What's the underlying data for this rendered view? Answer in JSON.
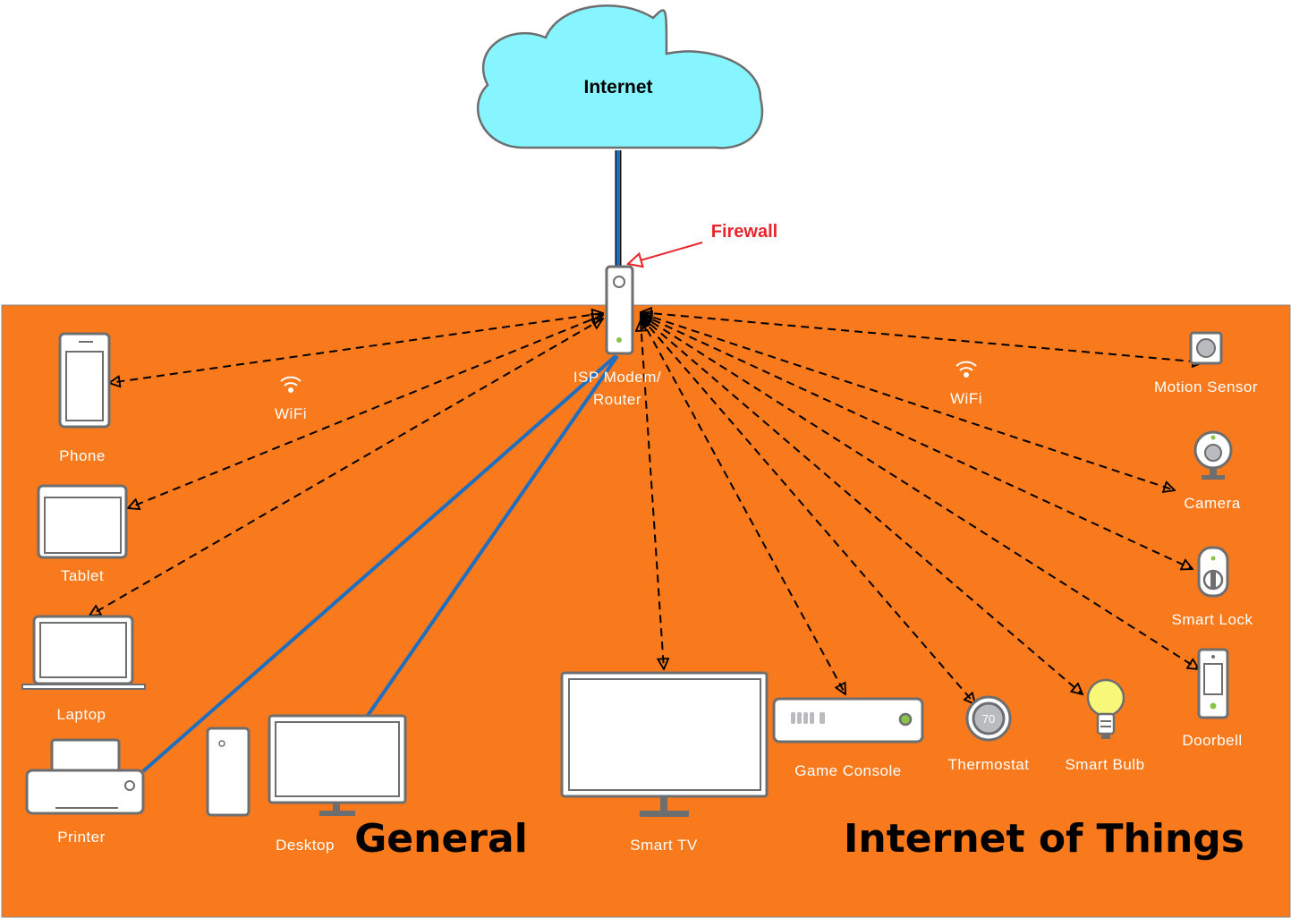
{
  "cloud": {
    "label": "Internet",
    "color": "#87f5ff"
  },
  "firewall": {
    "label": "Firewall",
    "color": "#e8262b"
  },
  "router": {
    "label_line1": "ISP Modem/",
    "label_line2": "Router"
  },
  "wifi_labels": {
    "left": "WiFi",
    "right": "WiFi"
  },
  "zones": {
    "general": "General",
    "iot": "Internet of Things",
    "background": "#f97a1c"
  },
  "devices": {
    "phone": "Phone",
    "tablet": "Tablet",
    "laptop": "Laptop",
    "printer": "Printer",
    "desktop": "Desktop",
    "smart_tv": "Smart TV",
    "game_console": "Game Console",
    "thermostat": "Thermostat",
    "thermostat_reading": "70",
    "smart_bulb": "Smart Bulb",
    "doorbell": "Doorbell",
    "smart_lock": "Smart Lock",
    "camera": "Camera",
    "motion_sensor": "Motion Sensor"
  },
  "connections": {
    "wireless": [
      "phone",
      "tablet",
      "laptop",
      "smart_tv",
      "game_console",
      "thermostat",
      "smart_bulb",
      "doorbell",
      "smart_lock",
      "camera",
      "motion_sensor"
    ],
    "wired": [
      "printer",
      "desktop"
    ],
    "wired_color": "#1f6fc0"
  }
}
